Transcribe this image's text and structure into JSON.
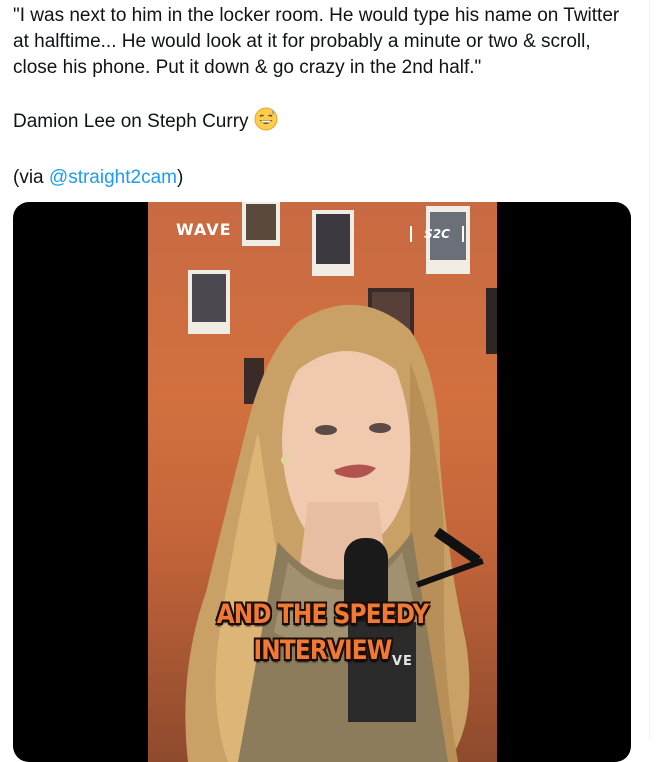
{
  "tweet": {
    "quote_lines": [
      "\"I was next to him in the locker room. He would type his name on Twitter",
      "at halftime... He would look at it for probably a minute or two & scroll,",
      "close his phone. Put it down & go crazy in the 2nd half.\""
    ],
    "attribution": "Damion Lee on Steph Curry",
    "attribution_emoji": "grinning-face-with-sweat-icon",
    "via_prefix": "(via ",
    "via_handle": "@straight2cam",
    "via_suffix": ")",
    "link_color": "#1d9bf0"
  },
  "media": {
    "type": "video",
    "watermark_left": "WAVE",
    "watermark_right": "S2C",
    "caption_lines": [
      "AND THE SPEEDY",
      "INTERVIEW"
    ],
    "caption_color": "#f07a34",
    "mic_label": "VE"
  }
}
